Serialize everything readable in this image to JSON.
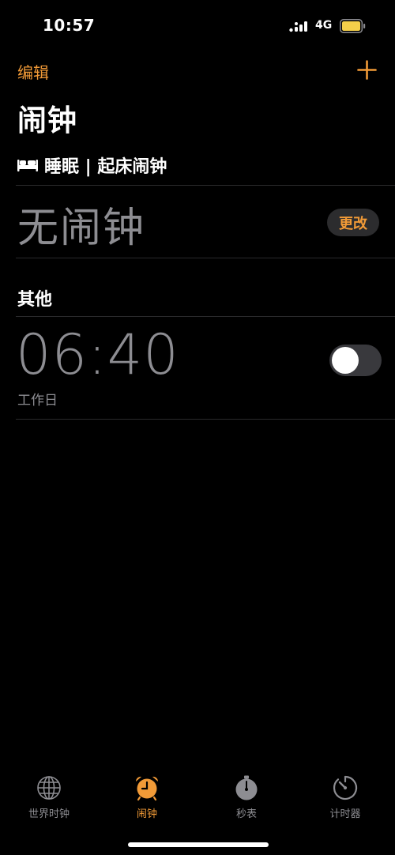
{
  "status_bar": {
    "time": "10:57",
    "network": "4G",
    "signal_icon": "signal-bars-icon",
    "battery_icon": "battery-icon",
    "battery_color": "#f4cf4a"
  },
  "nav": {
    "edit_label": "编辑",
    "add_icon": "plus-icon",
    "accent": "#f19a37"
  },
  "page_title": "闹钟",
  "sleep": {
    "icon": "bed-icon",
    "label": "睡眠 | 起床闹钟",
    "empty_text": "无闹钟",
    "change_label": "更改"
  },
  "other": {
    "header": "其他",
    "alarms": [
      {
        "time": "06:40",
        "label": "工作日",
        "enabled": false
      }
    ]
  },
  "tabbar": {
    "items": [
      {
        "label": "世界时钟",
        "icon": "globe-icon",
        "active": false
      },
      {
        "label": "闹钟",
        "icon": "alarm-clock-icon",
        "active": true
      },
      {
        "label": "秒表",
        "icon": "stopwatch-icon",
        "active": false
      },
      {
        "label": "计时器",
        "icon": "timer-icon",
        "active": false
      }
    ]
  }
}
